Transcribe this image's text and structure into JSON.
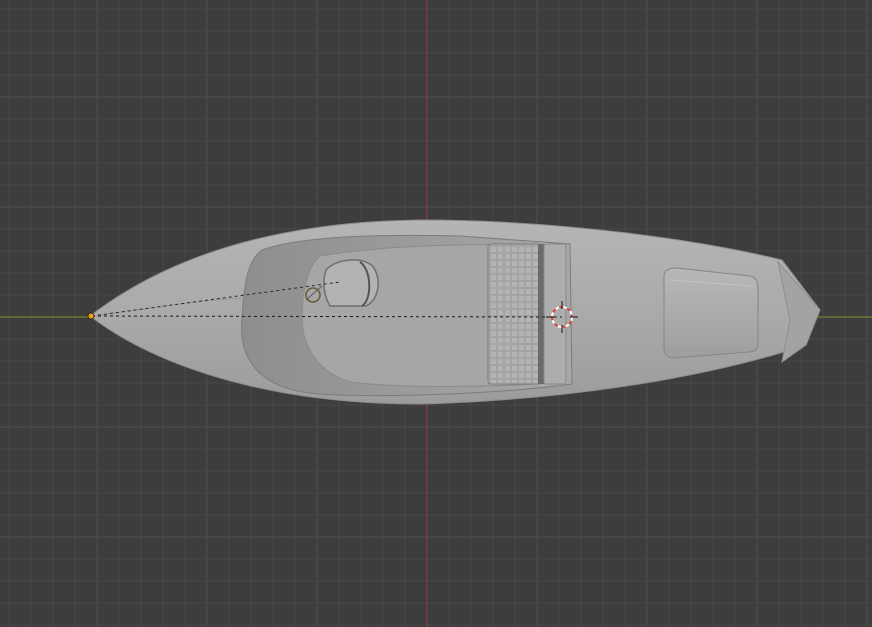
{
  "viewport": {
    "view": "Top Orthographic",
    "object": "boat hull",
    "colors": {
      "background": "#3d3d3d",
      "grid_minor": "#464646",
      "grid_major": "#4e4e4e",
      "axis_x": "#7a9a2e",
      "axis_y": "#9b3a3a",
      "mesh": "#a9a9a9",
      "origin": "#f39c1f",
      "cursor": "#e0453a"
    },
    "icons": {
      "origin": "origin-dot-icon",
      "cursor": "3d-cursor-icon"
    }
  }
}
